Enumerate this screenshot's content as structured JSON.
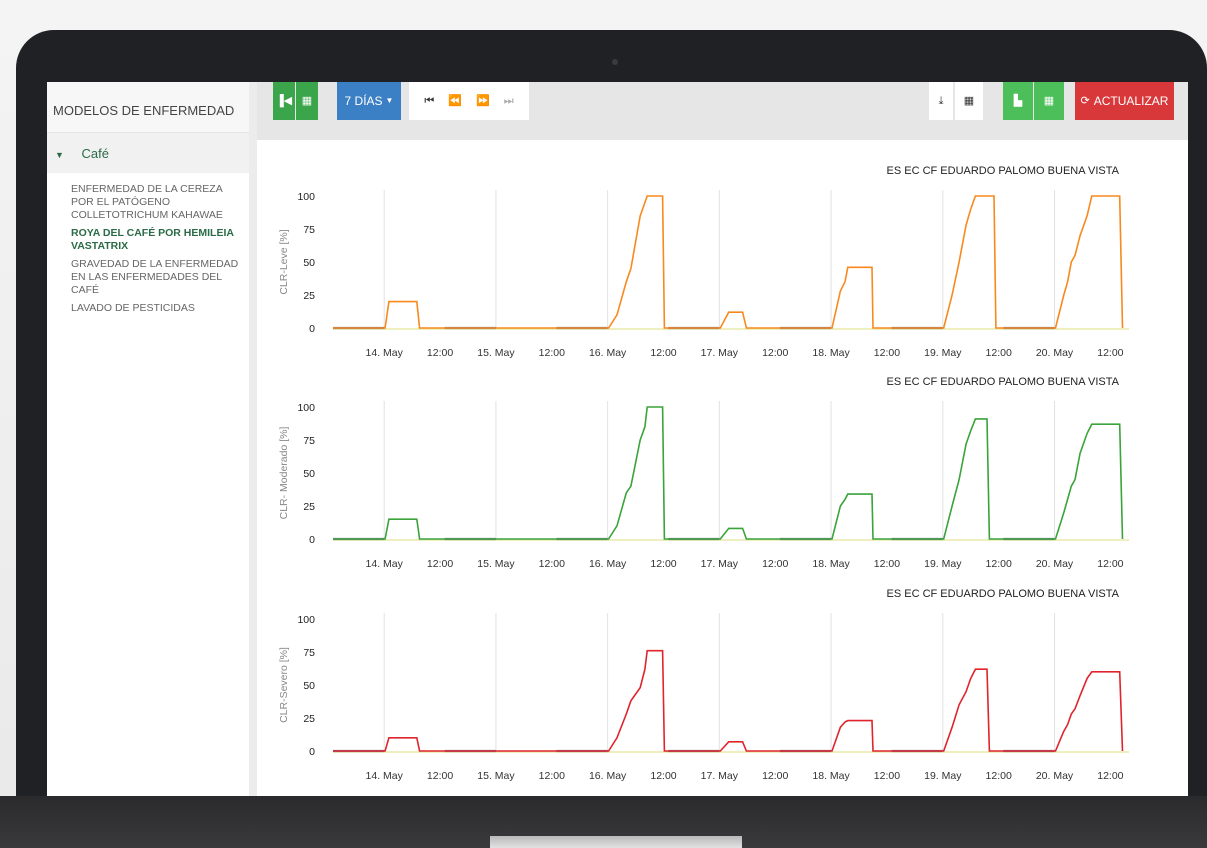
{
  "sidebar": {
    "title": "MODELOS DE ENFERMEDAD",
    "category": "Café",
    "items": [
      {
        "label": "ENFERMEDAD DE LA CEREZA POR EL PATÓGENO COLLETOTRICHUM KAHAWAE",
        "active": false
      },
      {
        "label": "ROYA DEL CAFÉ POR HEMILEIA VASTATRIX",
        "active": true
      },
      {
        "label": "GRAVEDAD DE LA ENFERMEDAD EN LAS ENFERMEDADES DEL CAFÉ",
        "active": false
      },
      {
        "label": "LAVADO DE PESTICIDAS",
        "active": false
      }
    ]
  },
  "toolbar": {
    "period_label": "7 DÍAS",
    "refresh_label": "ACTUALIZAR",
    "colors": {
      "green": "#3aa54a",
      "blue": "#3b7fc4",
      "red": "#d9383a",
      "lightgreen": "#4cbf5a"
    }
  },
  "chart_data": [
    {
      "type": "line",
      "title": "ES EC CF EDUARDO PALOMO BUENA VISTA",
      "ylabel": "CLR-Leve [%]",
      "ylim": [
        0,
        100
      ],
      "yticks": [
        0,
        25,
        50,
        75,
        100
      ],
      "xticks": [
        "14. May",
        "12:00",
        "15. May",
        "12:00",
        "16. May",
        "12:00",
        "17. May",
        "12:00",
        "18. May",
        "12:00",
        "19. May",
        "12:00",
        "20. May",
        "12:00"
      ],
      "x_unit": "hours since 14. May 00:00",
      "color": "#f7891e",
      "series": [
        {
          "values": [
            [
              0,
              0
            ],
            [
              11.2,
              0
            ],
            [
              12,
              20
            ],
            [
              18,
              20
            ],
            [
              18.6,
              0
            ],
            [
              35.2,
              0
            ],
            [
              59.2,
              0
            ],
            [
              61,
              10
            ],
            [
              63,
              35
            ],
            [
              64,
              45
            ],
            [
              66,
              85
            ],
            [
              67,
              95
            ],
            [
              67.5,
              100
            ],
            [
              70.8,
              100
            ],
            [
              71.2,
              0
            ],
            [
              83.2,
              0
            ],
            [
              85,
              12
            ],
            [
              88,
              12
            ],
            [
              88.8,
              0
            ],
            [
              107.2,
              0
            ],
            [
              109,
              28
            ],
            [
              110,
              35
            ],
            [
              110.6,
              46
            ],
            [
              115.8,
              46
            ],
            [
              116,
              0
            ],
            [
              131.2,
              0
            ],
            [
              133,
              25
            ],
            [
              134.5,
              50
            ],
            [
              136,
              78
            ],
            [
              137,
              90
            ],
            [
              138,
              100
            ],
            [
              142,
              100
            ],
            [
              142.4,
              0
            ],
            [
              155.2,
              0
            ],
            [
              157,
              25
            ],
            [
              157.8,
              35
            ],
            [
              158.6,
              50
            ],
            [
              159.4,
              55
            ],
            [
              160.5,
              70
            ],
            [
              162,
              85
            ],
            [
              163,
              100
            ],
            [
              169,
              100
            ],
            [
              169.6,
              0
            ]
          ]
        }
      ],
      "baseline_segments": [
        [
          0,
          11
        ],
        [
          24,
          35
        ],
        [
          48,
          59
        ],
        [
          72,
          83
        ],
        [
          96,
          107
        ],
        [
          120,
          131
        ],
        [
          144,
          155
        ]
      ]
    },
    {
      "type": "line",
      "title": "ES EC CF EDUARDO PALOMO BUENA VISTA",
      "ylabel": "CLR- Moderado [%]",
      "ylim": [
        0,
        100
      ],
      "yticks": [
        0,
        25,
        50,
        75,
        100
      ],
      "xticks": [
        "14. May",
        "12:00",
        "15. May",
        "12:00",
        "16. May",
        "12:00",
        "17. May",
        "12:00",
        "18. May",
        "12:00",
        "19. May",
        "12:00",
        "20. May",
        "12:00"
      ],
      "x_unit": "hours since 14. May 00:00",
      "color": "#3aa33a",
      "series": [
        {
          "values": [
            [
              0,
              0
            ],
            [
              11.2,
              0
            ],
            [
              12,
              15
            ],
            [
              18,
              15
            ],
            [
              18.6,
              0
            ],
            [
              35.2,
              0
            ],
            [
              59.2,
              0
            ],
            [
              61,
              10
            ],
            [
              63,
              35
            ],
            [
              64,
              40
            ],
            [
              66,
              75
            ],
            [
              67,
              85
            ],
            [
              67.5,
              100
            ],
            [
              70.8,
              100
            ],
            [
              71.2,
              0
            ],
            [
              83.2,
              0
            ],
            [
              85,
              8
            ],
            [
              88,
              8
            ],
            [
              88.8,
              0
            ],
            [
              107.2,
              0
            ],
            [
              109,
              25
            ],
            [
              110,
              30
            ],
            [
              110.6,
              34
            ],
            [
              115.8,
              34
            ],
            [
              116,
              0
            ],
            [
              131.2,
              0
            ],
            [
              133,
              25
            ],
            [
              134.5,
              45
            ],
            [
              136,
              72
            ],
            [
              137,
              82
            ],
            [
              138,
              91
            ],
            [
              140.5,
              91
            ],
            [
              141,
              0
            ],
            [
              155.2,
              0
            ],
            [
              157,
              20
            ],
            [
              157.8,
              30
            ],
            [
              158.6,
              40
            ],
            [
              159.4,
              45
            ],
            [
              160.5,
              65
            ],
            [
              162,
              80
            ],
            [
              163,
              87
            ],
            [
              169,
              87
            ],
            [
              169.6,
              0
            ]
          ]
        }
      ],
      "baseline_segments": [
        [
          0,
          11
        ],
        [
          24,
          35
        ],
        [
          48,
          59
        ],
        [
          72,
          83
        ],
        [
          96,
          107
        ],
        [
          120,
          131
        ],
        [
          144,
          155
        ]
      ]
    },
    {
      "type": "line",
      "title": "ES EC CF EDUARDO PALOMO BUENA VISTA",
      "ylabel": "CLR-Severo [%]",
      "ylim": [
        0,
        100
      ],
      "yticks": [
        0,
        25,
        50,
        75,
        100
      ],
      "xticks": [
        "14. May",
        "12:00",
        "15. May",
        "12:00",
        "16. May",
        "12:00",
        "17. May",
        "12:00",
        "18. May",
        "12:00",
        "19. May",
        "12:00",
        "20. May",
        "12:00"
      ],
      "x_unit": "hours since 14. May 00:00",
      "color": "#e0242b",
      "series": [
        {
          "values": [
            [
              0,
              0
            ],
            [
              11.2,
              0
            ],
            [
              12,
              10
            ],
            [
              18,
              10
            ],
            [
              18.6,
              0
            ],
            [
              35.2,
              0
            ],
            [
              59.2,
              0
            ],
            [
              61,
              10
            ],
            [
              63,
              28
            ],
            [
              64,
              38
            ],
            [
              66,
              48
            ],
            [
              67,
              62
            ],
            [
              67.5,
              76
            ],
            [
              70.8,
              76
            ],
            [
              71.2,
              0
            ],
            [
              83.2,
              0
            ],
            [
              85,
              7
            ],
            [
              88,
              7
            ],
            [
              88.8,
              0
            ],
            [
              107.2,
              0
            ],
            [
              109,
              18
            ],
            [
              110,
              22
            ],
            [
              110.6,
              23
            ],
            [
              115.8,
              23
            ],
            [
              116,
              0
            ],
            [
              131.2,
              0
            ],
            [
              133,
              18
            ],
            [
              134.5,
              35
            ],
            [
              136,
              45
            ],
            [
              137,
              55
            ],
            [
              138,
              62
            ],
            [
              140.5,
              62
            ],
            [
              141,
              0
            ],
            [
              155.2,
              0
            ],
            [
              157,
              15
            ],
            [
              157.8,
              20
            ],
            [
              158.6,
              28
            ],
            [
              159.4,
              32
            ],
            [
              160.5,
              42
            ],
            [
              162,
              55
            ],
            [
              163,
              60
            ],
            [
              169,
              60
            ],
            [
              169.6,
              0
            ]
          ]
        }
      ],
      "baseline_segments": [
        [
          0,
          11
        ],
        [
          24,
          35
        ],
        [
          48,
          59
        ],
        [
          72,
          83
        ],
        [
          96,
          107
        ],
        [
          120,
          131
        ],
        [
          144,
          155
        ]
      ]
    }
  ]
}
